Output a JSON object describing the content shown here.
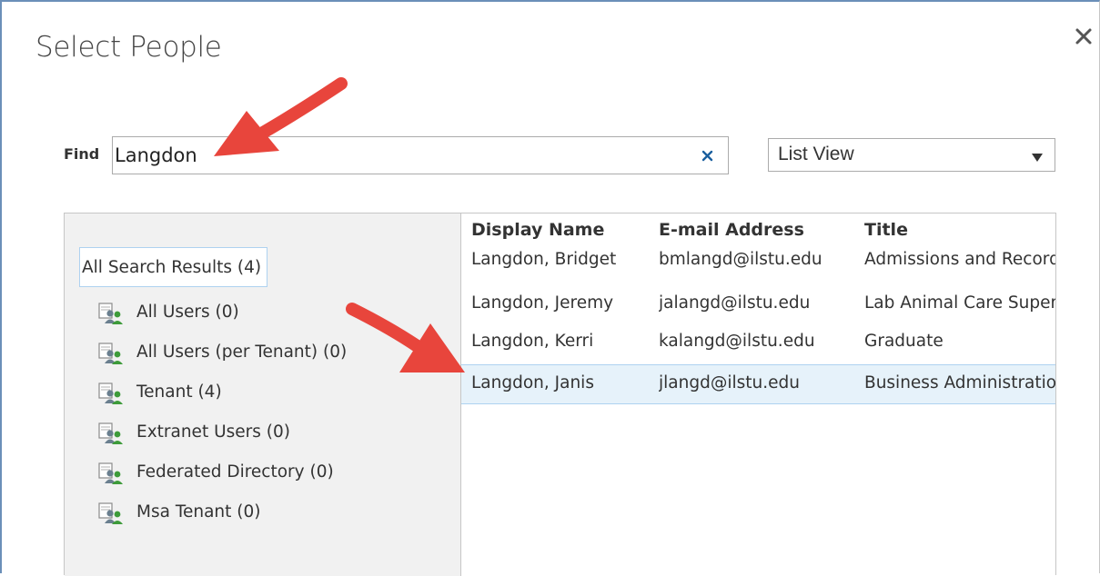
{
  "dialog": {
    "title": "Select People",
    "close_icon": "close-icon"
  },
  "find": {
    "label": "Find",
    "value": "Langdon",
    "clear_icon": "clear-x-icon"
  },
  "view": {
    "selected": "List View",
    "arrow_icon": "dropdown-arrow-icon"
  },
  "tree": {
    "root": "All Search Results (4)",
    "items": [
      {
        "label": "All Users (0)",
        "icon": "user-group-icon"
      },
      {
        "label": "All Users (per Tenant) (0)",
        "icon": "user-group-icon"
      },
      {
        "label": "Tenant (4)",
        "icon": "user-group-icon"
      },
      {
        "label": "Extranet Users (0)",
        "icon": "user-group-icon"
      },
      {
        "label": "Federated Directory (0)",
        "icon": "user-group-icon"
      },
      {
        "label": "Msa Tenant (0)",
        "icon": "user-group-icon"
      }
    ]
  },
  "results": {
    "columns": [
      "Display Name",
      "E-mail Address",
      "Title"
    ],
    "rows": [
      {
        "name": "Langdon, Bridget",
        "email": "bmlangd@ilstu.edu",
        "title": "Admissions and Records"
      },
      {
        "name": "Langdon, Jeremy",
        "email": "jalangd@ilstu.edu",
        "title": "Lab Animal Care Supervisor"
      },
      {
        "name": "Langdon, Kerri",
        "email": "kalangd@ilstu.edu",
        "title": "Graduate"
      },
      {
        "name": "Langdon, Janis",
        "email": "jlangd@ilstu.edu",
        "title": "Business Administration",
        "selected": true
      }
    ]
  },
  "annotations": {
    "arrow_color": "#e8453c"
  }
}
